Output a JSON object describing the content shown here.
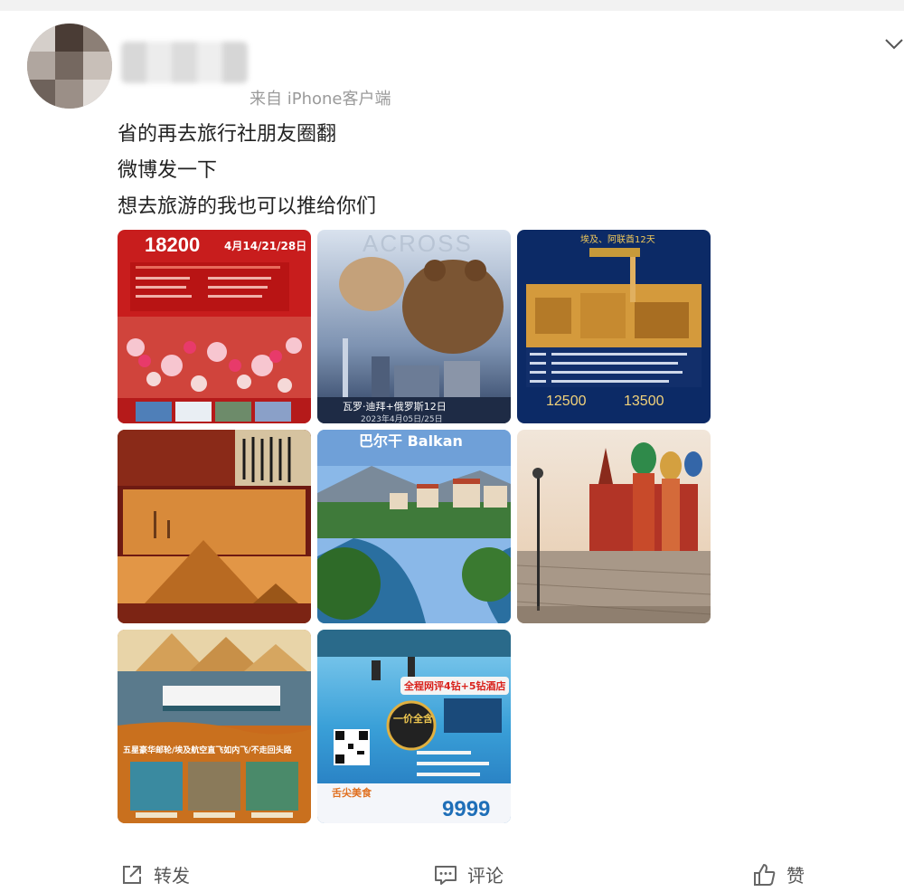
{
  "post": {
    "source": "来自 iPhone客户端",
    "lines": [
      "省的再去旅行社朋友圈翻",
      "微博发一下",
      "想去旅游的我也可以推给你们"
    ]
  },
  "images": [
    {
      "id": "tulips",
      "price": "18200",
      "dates": "4月14/21/28日"
    },
    {
      "id": "dubai-russia",
      "overlay": "ACROSS",
      "title": "瓦罗·迪拜+俄罗斯12日",
      "date": "2023年4月05日/25日"
    },
    {
      "id": "egypt-jordan",
      "title": "埃及、阿联酋12天",
      "price_a": "12500",
      "price_b": "13500"
    },
    {
      "id": "kenya-egypt"
    },
    {
      "id": "balkan",
      "title": "巴尔干 Balkan"
    },
    {
      "id": "moscow"
    },
    {
      "id": "nile-cruise",
      "caption": "五星豪华邮轮/埃及航空直飞如内飞/不走回头路"
    },
    {
      "id": "maldives",
      "badge": "全程网评4钻+5钻酒店",
      "tag": "一价全含",
      "price": "9999",
      "food": "舌尖美食"
    }
  ],
  "actions": {
    "repost": "转发",
    "comment": "评论",
    "like": "赞"
  },
  "colors": {
    "accent_red": "#d9231d",
    "text": "#222222",
    "meta": "#9a9a9a"
  }
}
